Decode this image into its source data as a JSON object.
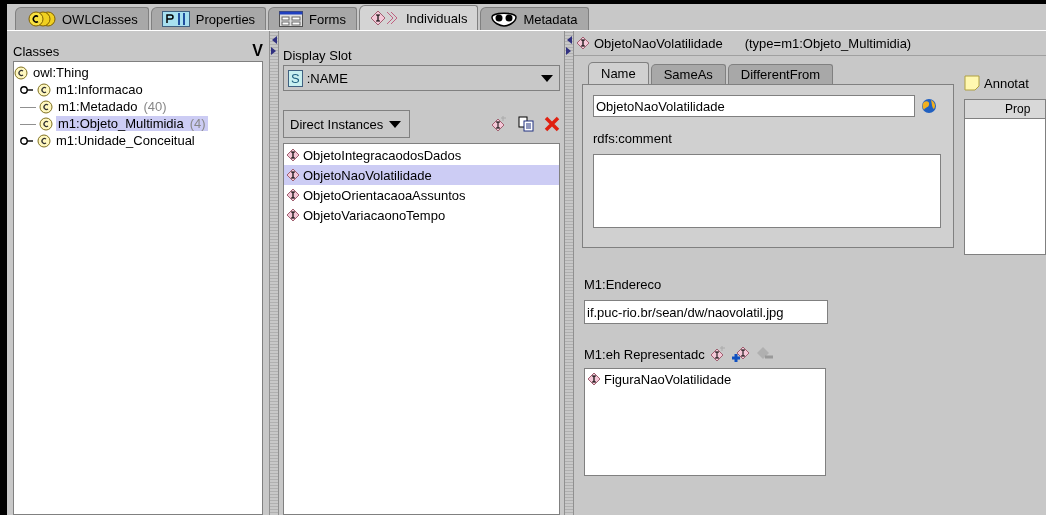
{
  "tabs": [
    {
      "label": "OWLClasses",
      "kind": "classes",
      "selected": false
    },
    {
      "label": "Properties",
      "kind": "properties",
      "selected": false
    },
    {
      "label": "Forms",
      "kind": "forms",
      "selected": false
    },
    {
      "label": "Individuals",
      "kind": "individuals",
      "selected": true
    },
    {
      "label": "Metadata",
      "kind": "metadata",
      "selected": false
    }
  ],
  "classes": {
    "title": "Classes",
    "corner_label": "V",
    "tree": [
      {
        "label": "owl:Thing",
        "selected": false,
        "children": [
          {
            "label": "m1:Informacao",
            "selected": false,
            "expanded": false
          },
          {
            "label": "m1:Metadado",
            "count": "(40)",
            "selected": false
          },
          {
            "label": "m1:Objeto_Multimidia",
            "count": "(4)",
            "selected": true
          },
          {
            "label": "m1:Unidade_Conceitual",
            "selected": false,
            "expanded": false
          }
        ]
      }
    ]
  },
  "instances": {
    "display_slot_label": "Display Slot",
    "display_slot": ":NAME",
    "slot_badge": "S",
    "filter": "Direct Instances",
    "items": [
      {
        "label": "ObjetoIntegracaodosDados",
        "selected": false
      },
      {
        "label": "ObjetoNaoVolatilidade",
        "selected": true
      },
      {
        "label": "ObjetoOrientacaoaAssuntos",
        "selected": false
      },
      {
        "label": "ObjetoVariacaonoTempo",
        "selected": false
      }
    ]
  },
  "editor": {
    "title": "ObjetoNaoVolatilidade",
    "type": "(type=m1:Objeto_Multimidia)",
    "tabs": [
      {
        "label": "Name",
        "selected": true
      },
      {
        "label": "SameAs",
        "selected": false
      },
      {
        "label": "DifferentFrom",
        "selected": false
      }
    ],
    "name_value": "ObjetoNaoVolatilidade",
    "comment_label": "rdfs:comment",
    "annotations_label": "Annotat",
    "annotations_column": "Prop",
    "endereco_label": "M1:Endereco",
    "endereco_value": "if.puc-rio.br/sean/dw/naovolatil.jpg",
    "representado_label": "M1:eh Representadc",
    "representado_items": [
      "FiguraNaoVolatilidade"
    ]
  }
}
